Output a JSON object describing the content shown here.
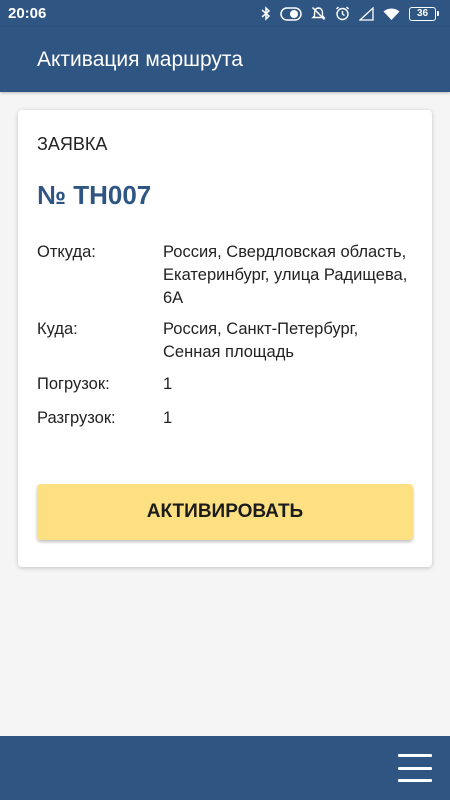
{
  "status_bar": {
    "time": "20:06",
    "battery": "36",
    "icons": [
      "bluetooth-icon",
      "dnd-toggle-icon",
      "alarm-off-icon",
      "alarm-icon",
      "signal-icon",
      "wifi-icon",
      "battery-icon"
    ]
  },
  "app_bar": {
    "title": "Активация маршрута"
  },
  "card": {
    "caption": "ЗАЯВКА",
    "order_number": "№ ТН007",
    "from_label": "Откуда:",
    "from_value": "Россия, Свердловская область, Екатеринбург, улица Радищева, 6А",
    "to_label": "Куда:",
    "to_value": "Россия, Санкт-Петербург, Сенная площадь",
    "loadings_label": "Погрузок:",
    "loadings_value": "1",
    "unloadings_label": "Разгрузок:",
    "unloadings_value": "1",
    "activate_label": "АКТИВИРОВАТЬ"
  },
  "bottom_bar": {
    "menu_icon": "hamburger-menu-icon"
  },
  "colors": {
    "primary": "#2f5583",
    "accent_button": "#fde082",
    "background": "#f5f5f5",
    "card": "#ffffff"
  }
}
